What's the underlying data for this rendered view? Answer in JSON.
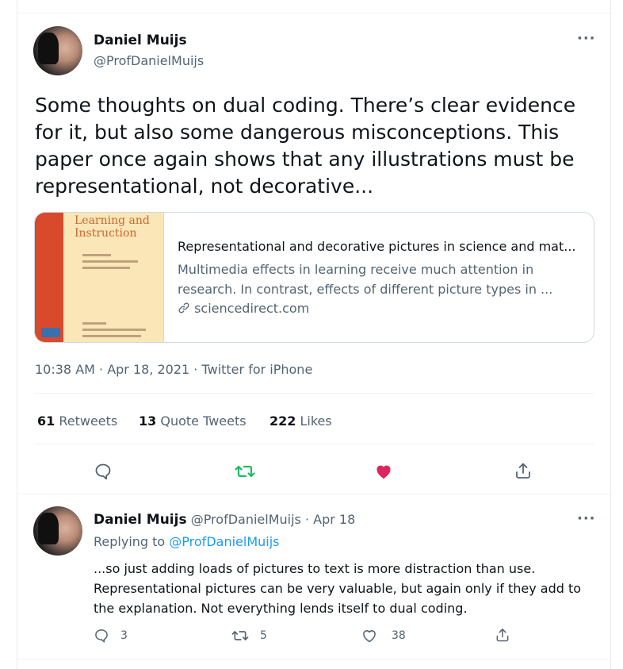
{
  "tweet": {
    "author_name": "Daniel Muijs",
    "author_handle": "@ProfDanielMuijs",
    "more_label": "···",
    "text": "Some thoughts on dual coding. There’s clear evidence for it, but also some dangerous misconceptions. This paper once again shows that any illustrations must be representational, not decorative...",
    "card": {
      "journal_title_line1": "Learning and",
      "journal_title_line2": "Instruction",
      "title": "Representational and decorative pictures in science and mat...",
      "description": "Multimedia effects in learning receive much attention in research. In contrast, effects of different picture types in ...",
      "domain": "sciencedirect.com"
    },
    "meta": "10:38 AM · Apr 18, 2021 · Twitter for iPhone",
    "stats": {
      "retweets_count": "61",
      "retweets_label": "Retweets",
      "quotes_count": "13",
      "quotes_label": "Quote Tweets",
      "likes_count": "222",
      "likes_label": "Likes"
    }
  },
  "reply": {
    "author_name": "Daniel Muijs",
    "author_handle_date": "@ProfDanielMuijs · Apr 18",
    "more_label": "···",
    "replying_prefix": "Replying to",
    "replying_to": "@ProfDanielMuijs",
    "text": "...so just adding loads of pictures to text is more distraction than use. Representational pictures can be very valuable, but again only if they add to the explanation. Not everything lends itself to dual coding.",
    "reply_count": "3",
    "retweet_count": "5",
    "like_count": "38"
  },
  "colors": {
    "retweet_active": "#17bf63",
    "like_active": "#e0245e",
    "link": "#1d9bf0",
    "secondary_text": "#536471"
  },
  "icons": [
    "reply-icon",
    "retweet-icon",
    "heart-icon",
    "share-icon",
    "link-icon",
    "more-icon"
  ]
}
